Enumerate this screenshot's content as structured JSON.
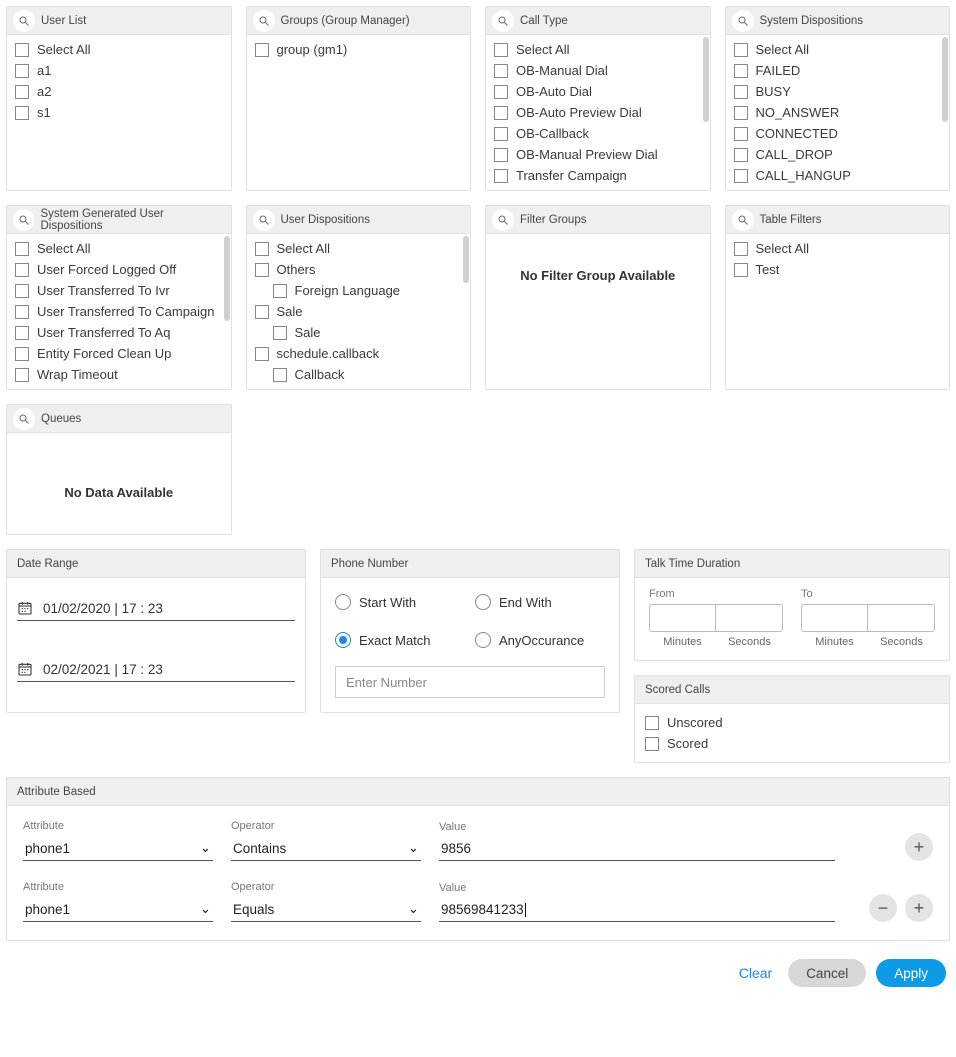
{
  "panels": {
    "userList": {
      "title": "User List",
      "items": [
        "Select All",
        "a1",
        "a2",
        "s1"
      ]
    },
    "groups": {
      "title": "Groups (Group Manager)",
      "items": [
        "group (gm1)"
      ]
    },
    "callType": {
      "title": "Call Type",
      "items": [
        "Select All",
        "OB-Manual Dial",
        "OB-Auto Dial",
        "OB-Auto Preview Dial",
        "OB-Callback",
        "OB-Manual Preview Dial",
        "Transfer Campaign"
      ]
    },
    "sysDisp": {
      "title": "System Dispositions",
      "items": [
        "Select All",
        "FAILED",
        "BUSY",
        "NO_ANSWER",
        "CONNECTED",
        "CALL_DROP",
        "CALL_HANGUP"
      ]
    },
    "sysGenUser": {
      "title": "System Generated User Dispositions",
      "items": [
        "Select All",
        "User Forced Logged Off",
        "User Transferred To Ivr",
        "User Transferred To Campaign",
        "User Transferred To Aq",
        "Entity Forced Clean Up",
        "Wrap Timeout"
      ]
    },
    "userDisp": {
      "title": "User Dispositions",
      "items": [
        {
          "label": "Select All",
          "indent": false
        },
        {
          "label": "Others",
          "indent": false
        },
        {
          "label": "Foreign Language",
          "indent": true
        },
        {
          "label": "Sale",
          "indent": false
        },
        {
          "label": "Sale",
          "indent": true
        },
        {
          "label": "schedule.callback",
          "indent": false
        },
        {
          "label": "Callback",
          "indent": true
        }
      ]
    },
    "filterGroups": {
      "title": "Filter Groups",
      "msg": "No Filter Group Available"
    },
    "tableFilters": {
      "title": "Table Filters",
      "items": [
        "Select All",
        "Test"
      ]
    },
    "queues": {
      "title": "Queues",
      "msg": "No Data Available"
    }
  },
  "dateRange": {
    "title": "Date Range",
    "from": "01/02/2020 | 17 : 23",
    "to": "02/02/2021 | 17 : 23"
  },
  "phone": {
    "title": "Phone Number",
    "options": {
      "start": "Start With",
      "end": "End With",
      "exact": "Exact Match",
      "any": "AnyOccurance"
    },
    "selected": "exact",
    "placeholder": "Enter Number"
  },
  "talk": {
    "title": "Talk Time Duration",
    "from": "From",
    "to": "To",
    "minutes": "Minutes",
    "seconds": "Seconds"
  },
  "scored": {
    "title": "Scored Calls",
    "items": [
      "Unscored",
      "Scored"
    ]
  },
  "attr": {
    "title": "Attribute Based",
    "labels": {
      "attribute": "Attribute",
      "operator": "Operator",
      "value": "Value"
    },
    "rows": [
      {
        "attribute": "phone1",
        "operator": "Contains",
        "value": "9856"
      },
      {
        "attribute": "phone1",
        "operator": "Equals",
        "value": "98569841233"
      }
    ]
  },
  "footer": {
    "clear": "Clear",
    "cancel": "Cancel",
    "apply": "Apply"
  }
}
